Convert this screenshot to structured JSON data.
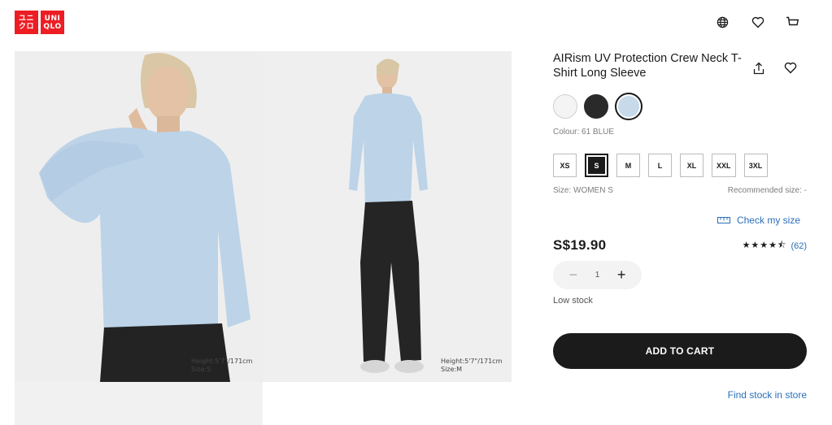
{
  "brand": {
    "logo_top": [
      "ユニ",
      "クロ"
    ],
    "logo_en": [
      "UNI",
      "QLO"
    ],
    "color": "#ed1d24"
  },
  "header": {
    "icons": [
      "globe-icon",
      "heart-icon",
      "cart-icon"
    ]
  },
  "gallery": {
    "photo1_caption": [
      "Height:5'7\"/171cm",
      "Size:S"
    ],
    "photo2_caption": [
      "Height:5'7\"/171cm",
      "Size:M"
    ]
  },
  "product": {
    "title": "AIRism UV Protection Crew Neck T-Shirt Long Sleeve",
    "colours": [
      {
        "name": "white",
        "hex": "#f4f4f4",
        "selected": false
      },
      {
        "name": "black",
        "hex": "#2a2a2a",
        "selected": false
      },
      {
        "name": "61 BLUE",
        "hex": "#c6daea",
        "selected": true
      }
    ],
    "colour_label": "Colour: 61 BLUE",
    "sizes": [
      {
        "label": "XS",
        "selected": false
      },
      {
        "label": "S",
        "selected": true
      },
      {
        "label": "M",
        "selected": false
      },
      {
        "label": "L",
        "selected": false
      },
      {
        "label": "XL",
        "selected": false
      },
      {
        "label": "XXL",
        "selected": false
      },
      {
        "label": "3XL",
        "selected": false
      }
    ],
    "size_label": "Size: WOMEN S",
    "recommended": "Recommended size: -",
    "check_size": "Check my size",
    "price": "S$19.90",
    "rating_stars": "★★★★⯪",
    "rating_value": 4.5,
    "reviews": "(62)",
    "quantity": "1",
    "stock": "Low stock",
    "add_to_cart": "ADD TO CART",
    "find_stock": "Find stock in store"
  }
}
